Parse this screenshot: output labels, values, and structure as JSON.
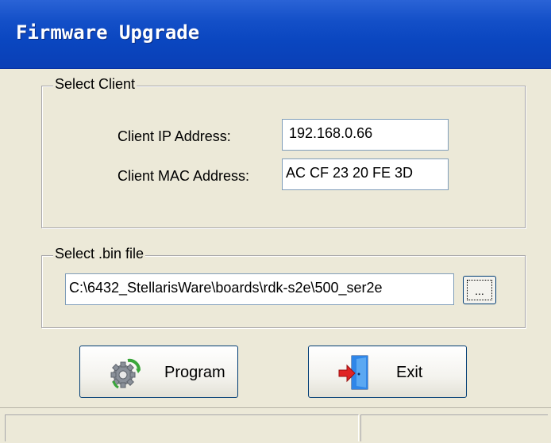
{
  "window": {
    "title": "Firmware Upgrade"
  },
  "select_client": {
    "legend": "Select Client",
    "ip_label": "Client IP Address:",
    "ip_value": "192.168.0.66",
    "mac_label": "Client MAC Address:",
    "mac_value": "AC CF 23 20 FE 3D"
  },
  "select_bin": {
    "legend": "Select .bin file",
    "path_value": "C:\\6432_StellarisWare\\boards\\rdk-s2e\\500_ser2e",
    "browse_label": "..."
  },
  "buttons": {
    "program_label": "Program",
    "program_icon": "gears-icon",
    "exit_label": "Exit",
    "exit_icon": "exit-door-icon"
  },
  "colors": {
    "titlebar": "#0a46c0",
    "window_bg": "#ece9d8"
  }
}
